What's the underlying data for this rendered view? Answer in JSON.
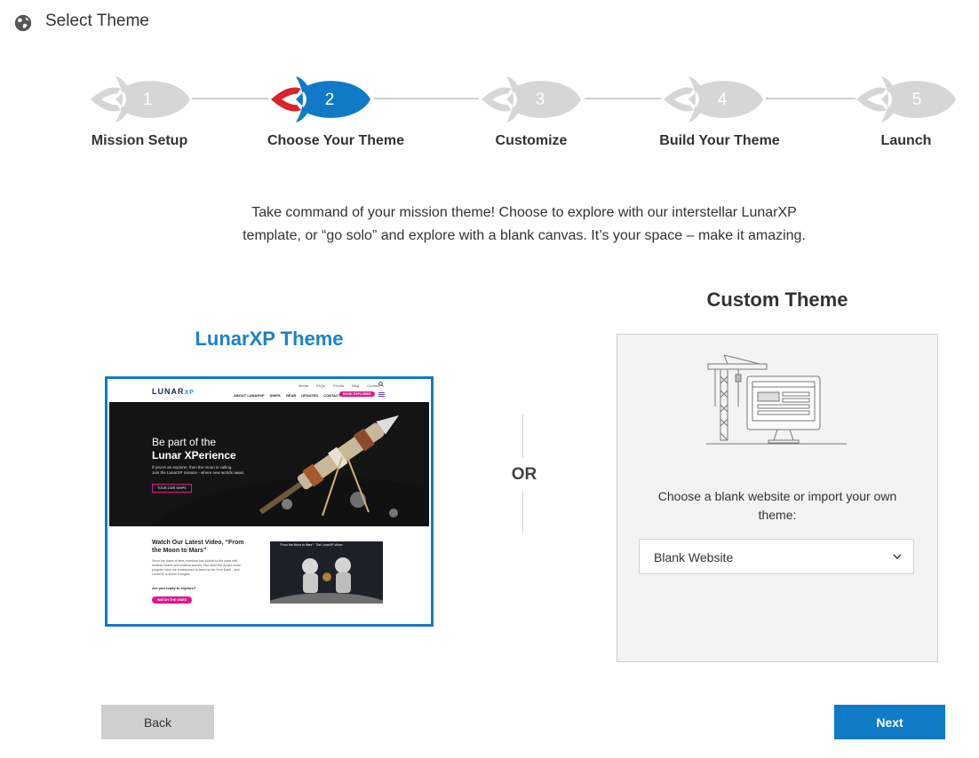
{
  "header": {
    "title": "Select Theme",
    "icon": "globe-icon"
  },
  "steps": [
    {
      "number": "1",
      "label": "Mission Setup",
      "state": "inactive"
    },
    {
      "number": "2",
      "label": "Choose Your Theme",
      "state": "active"
    },
    {
      "number": "3",
      "label": "Customize",
      "state": "inactive"
    },
    {
      "number": "4",
      "label": "Build Your Theme",
      "state": "inactive"
    },
    {
      "number": "5",
      "label": "Launch",
      "state": "inactive"
    }
  ],
  "intro": {
    "line1": "Take command of your mission theme! Choose to explore with our interstellar LunarXP",
    "line2": "template, or “go solo” and explore with a blank canvas. It’s your space – make it amazing."
  },
  "lunar": {
    "title": "LunarXP Theme",
    "preview": {
      "logo_text": "LUNAR",
      "logo_suffix": "XP",
      "top_links": [
        "Media",
        "FAQs",
        "Events",
        "Blog",
        "Contact"
      ],
      "nav": [
        "ABOUT LUNARXP",
        "SHIPS",
        "GEAR",
        "UPDATES",
        "CONTACT"
      ],
      "nav_cta": "BOOK EXPLORER",
      "hero_line1": "Be part of the",
      "hero_line2": "Lunar XPerience",
      "hero_sub1": "If you’re an explorer, then the moon is calling.",
      "hero_sub2": "Join the LunarXP mission - where new worlds await.",
      "hero_button": "TOUR OUR SHIPS",
      "video_heading1": "Watch Our Latest Video, “From",
      "video_heading2": "the Moon to Mars”",
      "video_body": "Since the dawn of time, mankind has looked to the stars with restless hearts and endless wonder. Not since the Apollo moon program have we endeavored to travel so far from Earth - and LunarXP is where it begins.",
      "video_question": "Are you ready to explore?",
      "video_button": "WATCH THE VIDEO",
      "video_caption": "“From the Moon to Mars” · The LunarXP Vision"
    }
  },
  "divider": {
    "text": "OR"
  },
  "custom": {
    "title": "Custom Theme",
    "illustration": "crane-building-website-icon",
    "description_line1": "Choose a blank website or import your own",
    "description_line2": "theme:",
    "select_value": "Blank Website"
  },
  "buttons": {
    "back": "Back",
    "next": "Next"
  },
  "colors": {
    "accent": "#0f7ac6",
    "title_blue": "#1a82c8",
    "inactive_rocket": "#d6d6d6",
    "active_flame": "#d8232a",
    "magenta": "#e0168c"
  }
}
